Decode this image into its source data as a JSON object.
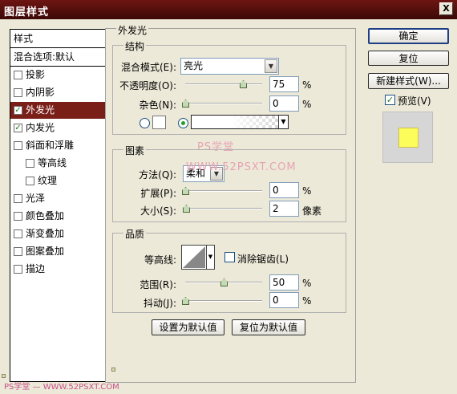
{
  "window": {
    "title": "图层样式",
    "close_label": "X"
  },
  "styles_list": {
    "header": "样式",
    "blend_options": "混合选项:默认",
    "items": [
      {
        "label": "投影",
        "checked": false,
        "indent": false,
        "selected": false
      },
      {
        "label": "内阴影",
        "checked": false,
        "indent": false,
        "selected": false
      },
      {
        "label": "外发光",
        "checked": true,
        "indent": false,
        "selected": true
      },
      {
        "label": "内发光",
        "checked": true,
        "indent": false,
        "selected": false
      },
      {
        "label": "斜面和浮雕",
        "checked": false,
        "indent": false,
        "selected": false
      },
      {
        "label": "等高线",
        "checked": false,
        "indent": true,
        "selected": false
      },
      {
        "label": "纹理",
        "checked": false,
        "indent": true,
        "selected": false
      },
      {
        "label": "光泽",
        "checked": false,
        "indent": false,
        "selected": false
      },
      {
        "label": "颜色叠加",
        "checked": false,
        "indent": false,
        "selected": false
      },
      {
        "label": "渐变叠加",
        "checked": false,
        "indent": false,
        "selected": false
      },
      {
        "label": "图案叠加",
        "checked": false,
        "indent": false,
        "selected": false
      },
      {
        "label": "描边",
        "checked": false,
        "indent": false,
        "selected": false
      }
    ],
    "check_mark": "✓"
  },
  "panel": {
    "title": "外发光",
    "structure": {
      "title": "结构",
      "blend_mode_label": "混合模式(E):",
      "blend_mode_value": "亮光",
      "opacity_label": "不透明度(O):",
      "opacity_value": "75",
      "opacity_level": 0.75,
      "noise_label": "杂色(N):",
      "noise_value": "0",
      "noise_level": 0,
      "percent": "%"
    },
    "elements": {
      "title": "图素",
      "technique_label": "方法(Q):",
      "technique_value": "柔和",
      "spread_label": "扩展(P):",
      "spread_value": "0",
      "spread_level": 0,
      "size_label": "大小(S):",
      "size_value": "2",
      "size_level": 0.01,
      "percent": "%",
      "pixels": "像素"
    },
    "quality": {
      "title": "品质",
      "contour_label": "等高线:",
      "anti_alias_label": "消除锯齿(L)",
      "range_label": "范围(R):",
      "range_value": "50",
      "range_level": 0.5,
      "jitter_label": "抖动(J):",
      "jitter_value": "0",
      "jitter_level": 0,
      "percent": "%"
    },
    "make_default": "设置为默认值",
    "reset_default": "复位为默认值"
  },
  "right": {
    "ok": "确定",
    "reset": "复位",
    "new_style": "新建样式(W)...",
    "preview_label": "预览(V)",
    "preview_checked": true,
    "preview_color": "#fcfc5a"
  },
  "watermarks": {
    "center_top": "PS学堂",
    "center_mid": "WWW.52PSXT.COM",
    "bottom_left": "PS学堂 — WWW.52PSXT.COM"
  },
  "colors": {
    "selected_bg": "#7a1f18",
    "title_bar": "#5a100d"
  }
}
